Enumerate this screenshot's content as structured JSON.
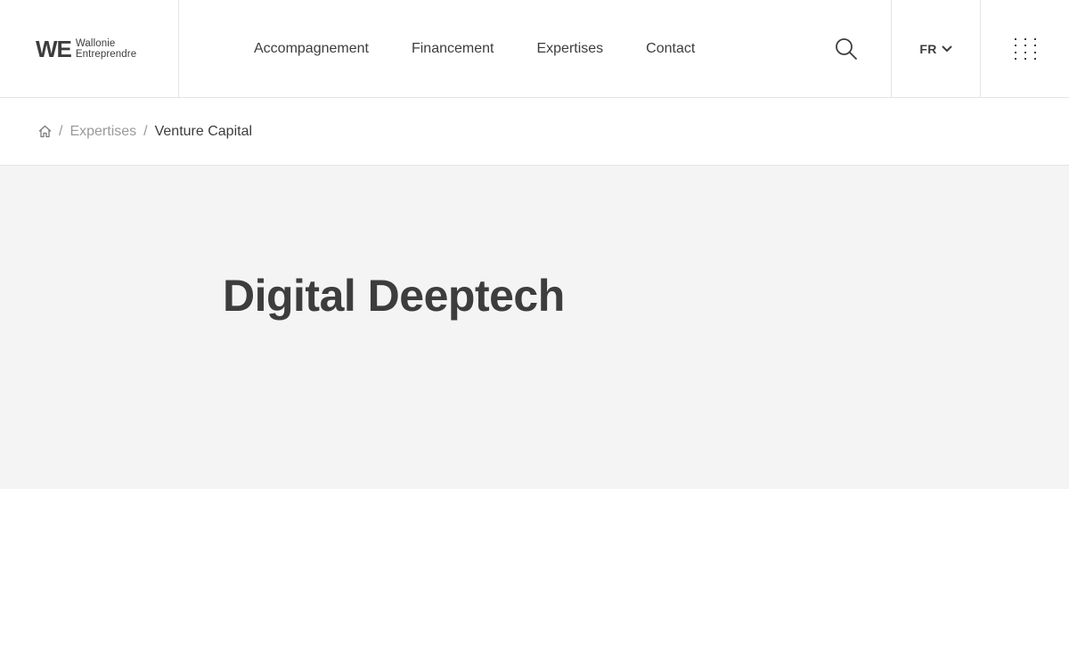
{
  "logo": {
    "mark": "WE",
    "line1": "Wallonie",
    "line2": "Entreprendre"
  },
  "nav": {
    "items": [
      {
        "label": "Accompagnement"
      },
      {
        "label": "Financement"
      },
      {
        "label": "Expertises"
      },
      {
        "label": "Contact"
      }
    ]
  },
  "header": {
    "search_icon": "search-icon",
    "language": {
      "selected": "FR",
      "icon": "chevron-down-icon"
    },
    "menu_icon": "grid-menu-icon"
  },
  "breadcrumb": {
    "home_icon": "home-icon",
    "separator": "/",
    "items": [
      {
        "label": "Expertises"
      },
      {
        "label": "Venture Capital"
      }
    ]
  },
  "hero": {
    "title": "Digital Deeptech"
  },
  "colors": {
    "text": "#3d3d3d",
    "muted": "#9a9a9a",
    "border": "#e4e4e4",
    "hero_bg": "#f4f4f4"
  }
}
